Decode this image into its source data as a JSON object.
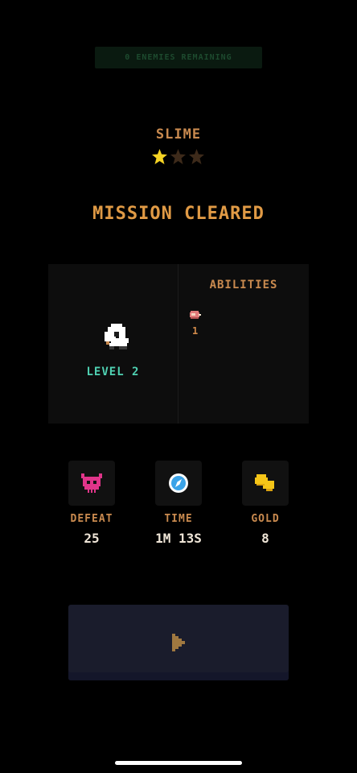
{
  "banner": {
    "enemies_remaining": "0 ENEMIES REMAINING"
  },
  "mission": {
    "enemy_name": "SLIME",
    "stars_earned": 1,
    "stars_total": 3,
    "title": "MISSION CLEARED"
  },
  "hero": {
    "level_label": "LEVEL 2"
  },
  "abilities": {
    "title": "ABILITIES",
    "items": [
      {
        "icon": "meat-icon",
        "count": "1"
      }
    ]
  },
  "stats": [
    {
      "label": "DEFEAT",
      "value": "25",
      "icon": "demon-skull-icon"
    },
    {
      "label": "TIME",
      "value": "1M 13S",
      "icon": "compass-icon"
    },
    {
      "label": "GOLD",
      "value": "8",
      "icon": "gold-coin-icon"
    }
  ],
  "colors": {
    "background": "#000000",
    "accent_orange": "#e09a45",
    "level_teal": "#4fd1b2",
    "star_filled": "#f5d324",
    "star_empty": "#3d2a1a",
    "button": "#1a1c2c"
  },
  "controls": {
    "continue_icon": "play-icon"
  }
}
